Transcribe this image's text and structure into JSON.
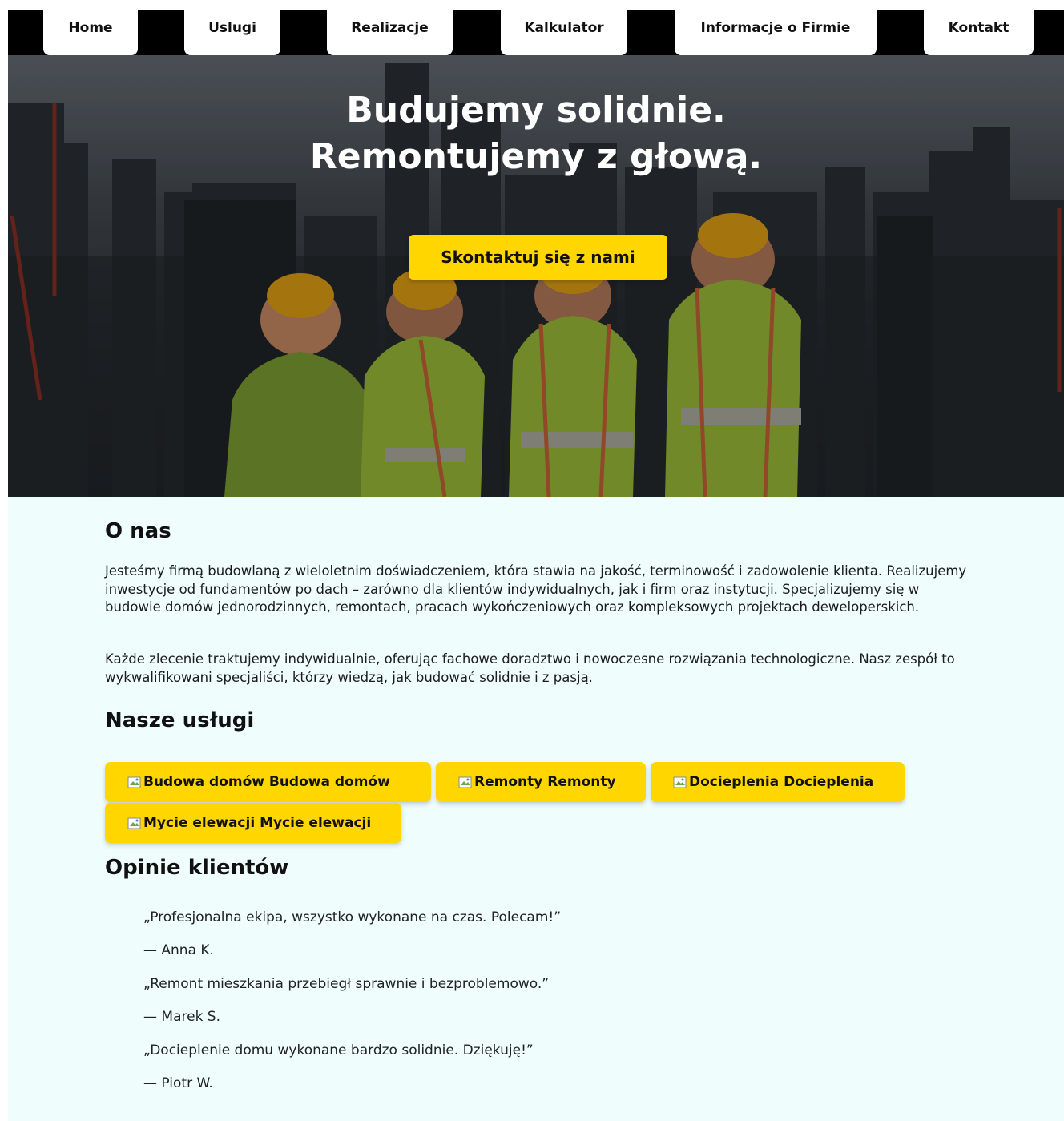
{
  "nav": {
    "items": [
      {
        "label": "Home"
      },
      {
        "label": "Uslugi"
      },
      {
        "label": "Realizacje"
      },
      {
        "label": "Kalkulator"
      },
      {
        "label": "Informacje o Firmie"
      },
      {
        "label": "Kontakt"
      }
    ]
  },
  "hero": {
    "title_line1": "Budujemy solidnie.",
    "title_line2": "Remontujemy z głową.",
    "cta_label": "Skontaktuj się z nami"
  },
  "about": {
    "title": "O nas",
    "paragraph1": "Jesteśmy firmą budowlaną z wieloletnim doświadczeniem, która stawia na jakość, terminowość i zadowolenie klienta. Realizujemy inwestycje od fundamentów po dach – zarówno dla klientów indywidualnych, jak i firm oraz instytucji. Specjalizujemy się w budowie domów jednorodzinnych, remontach, pracach wykończeniowych oraz kompleksowych projektach deweloperskich.",
    "paragraph2": "Każde zlecenie traktujemy indywidualnie, oferując fachowe doradztwo i nowoczesne rozwiązania technologiczne. Nasz zespół to wykwalifikowani specjaliści, którzy wiedzą, jak budować solidnie i z pasją."
  },
  "services": {
    "title": "Nasze usługi",
    "items": [
      {
        "label": "Budowa domów Budowa domów"
      },
      {
        "label": "Remonty Remonty"
      },
      {
        "label": "Docieplenia Docieplenia"
      },
      {
        "label": "Mycie elewacji Mycie elewacji"
      }
    ]
  },
  "reviews": {
    "title": "Opinie klientów",
    "items": [
      {
        "quote": "„Profesjonalna ekipa, wszystko wykonane na czas. Polecam!”",
        "author": "— Anna K."
      },
      {
        "quote": "„Remont mieszkania przebiegł sprawnie i bezproblemowo.”",
        "author": "— Marek S."
      },
      {
        "quote": "„Docieplenie domu wykonane bardzo solidnie. Dziękuję!”",
        "author": "— Piotr W."
      }
    ]
  },
  "colors": {
    "accent": "#ffd600",
    "nav_bg": "#000000",
    "page_bg": "#effdfd"
  },
  "icons": {
    "service_image": "broken-image-icon"
  }
}
